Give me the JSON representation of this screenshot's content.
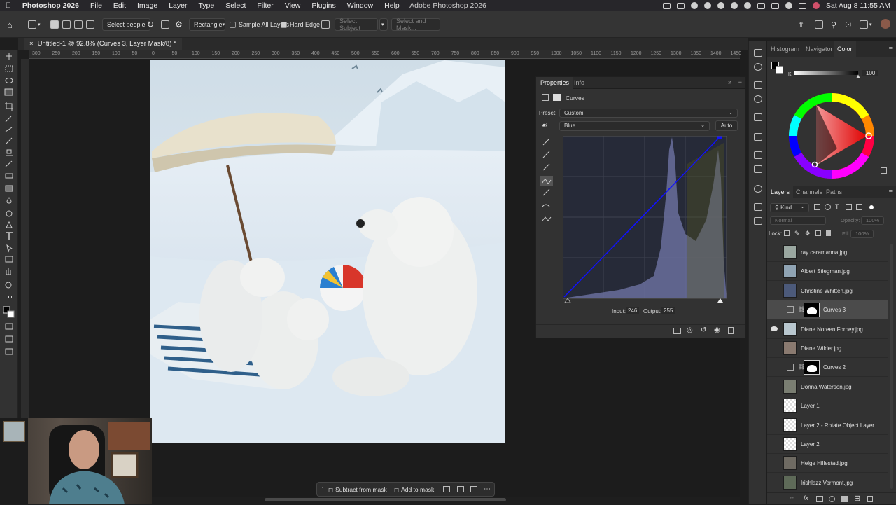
{
  "menubar": {
    "app_name": "Photoshop 2026",
    "items": [
      "File",
      "Edit",
      "Image",
      "Layer",
      "Type",
      "Select",
      "Filter",
      "View",
      "Plugins",
      "Window",
      "Help"
    ],
    "window_title": "Adobe Photoshop 2026",
    "clock": "Sat Aug 8  11:55 AM"
  },
  "options_bar": {
    "select_people": "Select people",
    "shape_dropdown": "Rectangle",
    "sample_all_layers": "Sample All Layers",
    "sample_all_layers_checked": false,
    "hard_edge": "Hard Edge",
    "hard_edge_checked": true,
    "select_subject": "Select Subject",
    "select_and_mask": "Select and Mask..."
  },
  "document": {
    "tab_title": "Untitled-1 @ 92.8% (Curves 3, Layer Mask/8) *"
  },
  "ruler": {
    "h_ticks": [
      "300",
      "250",
      "200",
      "150",
      "100",
      "50",
      "0",
      "50",
      "100",
      "150",
      "200",
      "250",
      "300",
      "350",
      "400",
      "450",
      "500",
      "550",
      "600",
      "650",
      "700",
      "750",
      "800",
      "850",
      "900",
      "950",
      "1000",
      "1050",
      "1100",
      "1150",
      "1200",
      "1250",
      "1300",
      "1350",
      "1400",
      "1450"
    ]
  },
  "properties": {
    "tabs": [
      "Properties",
      "Info"
    ],
    "active_tab": "Properties",
    "adjustment_name": "Curves",
    "preset_label": "Preset:",
    "preset_value": "Custom",
    "channel_value": "Blue",
    "auto_label": "Auto",
    "input_label": "Input:",
    "input_value": "246",
    "output_label": "Output:",
    "output_value": "255"
  },
  "color_panel": {
    "tabs": [
      "Histogram",
      "Navigator",
      "Color"
    ],
    "active_tab": "Color",
    "channel_letter": "K",
    "k_value": "100"
  },
  "layers_panel": {
    "tabs": [
      "Layers",
      "Channels",
      "Paths"
    ],
    "active_tab": "Layers",
    "filter_kind": "Kind",
    "blend_mode": "Normal",
    "opacity_label": "Opacity:",
    "opacity_value": "100%",
    "lock_label": "Lock:",
    "fill_label": "Fill:",
    "fill_value": "100%",
    "layers": [
      {
        "name": "ray caramanna.jpg",
        "type": "image",
        "visible": false,
        "selected": false
      },
      {
        "name": "Albert Stiegman.jpg",
        "type": "image",
        "visible": false,
        "selected": false
      },
      {
        "name": "Christine Whitten.jpg",
        "type": "image",
        "visible": false,
        "selected": false
      },
      {
        "name": "Curves 3",
        "type": "adjustment",
        "visible": false,
        "selected": true
      },
      {
        "name": "Diane Noreen Forney.jpg",
        "type": "image",
        "visible": true,
        "selected": false
      },
      {
        "name": "Diane Wilder.jpg",
        "type": "image",
        "visible": false,
        "selected": false
      },
      {
        "name": "Curves 2",
        "type": "adjustment",
        "visible": false,
        "selected": false
      },
      {
        "name": "Donna Waterson.jpg",
        "type": "image",
        "visible": false,
        "selected": false
      },
      {
        "name": "Layer 1",
        "type": "transparent",
        "visible": false,
        "selected": false
      },
      {
        "name": "Layer 2 - Rotate Object Layer",
        "type": "transparent",
        "visible": false,
        "selected": false
      },
      {
        "name": "Layer 2",
        "type": "transparent",
        "visible": false,
        "selected": false
      },
      {
        "name": "Helge Hillestad.jpg",
        "type": "image",
        "visible": false,
        "selected": false
      },
      {
        "name": "Irishlazz Vermont.jpg",
        "type": "image",
        "visible": false,
        "selected": false
      }
    ]
  },
  "mask_bar": {
    "subtract": "Subtract from mask",
    "add": "Add to mask"
  },
  "colors": {
    "app_bg": "#1e1e1e",
    "panel_bg": "#323232",
    "curve_line": "#1010ff",
    "curve_bg": "#2a2f3a"
  }
}
